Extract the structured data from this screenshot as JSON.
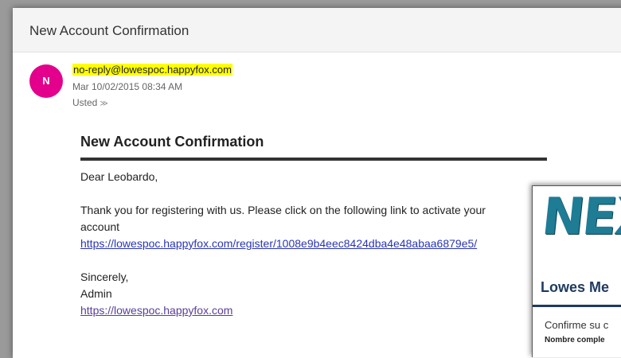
{
  "email": {
    "subject": "New Account Confirmation",
    "avatar_initial": "N",
    "sender": "no-reply@lowespoc.happyfox.com",
    "date": "Mar 10/02/2015 08:34 AM",
    "recipient": "Usted",
    "recipient_chevron": "≫",
    "body": {
      "heading": "New Account Confirmation",
      "greeting": "Dear Leobardo,",
      "message_line1": "Thank you for registering with us. Please click on the following link to activate your",
      "message_line2": "account",
      "activation_link": "https://lowespoc.happyfox.com/register/1008e9b4eec8424dba4e48abaa6879e5/",
      "closing": "Sincerely,",
      "signature": "Admin",
      "site_link": "https://lowespoc.happyfox.com"
    }
  },
  "overlay": {
    "logo": "NEX",
    "title": "Lowes Me",
    "text1": "Confirme su c",
    "text2": "Nombre comple"
  },
  "colors": {
    "avatar": "#e3008c",
    "highlight": "#ffff00",
    "link": "#2a35b3",
    "logo": "#1e7c95"
  }
}
